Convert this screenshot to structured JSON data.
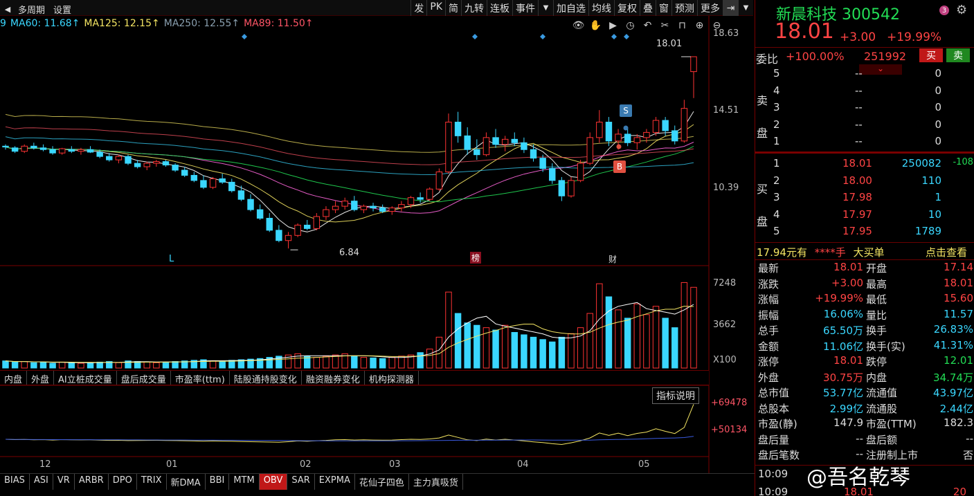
{
  "toolbar": {
    "left": [
      "多周期",
      "设置"
    ],
    "right": [
      "发",
      "PK",
      "简",
      "九转",
      "连板",
      "事件",
      "加自选",
      "均线",
      "复权",
      "叠",
      "窗",
      "预测",
      "更多"
    ]
  },
  "ma": [
    {
      "label": "9",
      "color": "#3ad7ff"
    },
    {
      "label": "MA60: 11.68↑",
      "color": "#3ad7ff"
    },
    {
      "label": "MA125: 12.15↑",
      "color": "#f5e663"
    },
    {
      "label": "MA250: 12.55↑",
      "color": "#8aa0b0"
    },
    {
      "label": "MA89: 11.50↑",
      "color": "#ff5566"
    }
  ],
  "price_axis": [
    "18.63",
    "14.51",
    "10.39"
  ],
  "vol_axis": [
    "7248",
    "3662",
    "X100"
  ],
  "obv_axis": [
    "+69478",
    "+50134"
  ],
  "x_axis": [
    "12",
    "01",
    "02",
    "03",
    "04",
    "05"
  ],
  "markers": {
    "low": "6.84",
    "high": "18.01",
    "L": "L",
    "bang": "榜",
    "cai": "财",
    "S": "S",
    "B": "B",
    "indicator_help": "指标说明"
  },
  "tabs_mid": [
    "内盘",
    "外盘",
    "AI立桩成交量",
    "盘后成交量",
    "市盈率(ttm)",
    "陆股通持股变化",
    "融资融券变化",
    "机构探测器"
  ],
  "tabs_bottom": [
    "BIAS",
    "ASI",
    "VR",
    "ARBR",
    "DPO",
    "TRIX",
    "新DMA",
    "BBI",
    "MTM",
    "OBV",
    "SAR",
    "EXPMA",
    "花仙子四色",
    "主力真吸货"
  ],
  "active_tab": "OBV",
  "stock": {
    "name": "新晨科技",
    "code": "300542",
    "badge": "3",
    "price": "18.01",
    "change": "+3.00",
    "pct": "+19.99%",
    "weibi_label": "委比",
    "weibi": "+100.00%",
    "weicha": "251992",
    "buy_btn": "买",
    "sell_btn": "卖"
  },
  "sell_label": [
    "卖",
    "盘"
  ],
  "buy_label": [
    "买",
    "盘"
  ],
  "asks": [
    {
      "lvl": "5",
      "price": "--",
      "vol": "0"
    },
    {
      "lvl": "4",
      "price": "--",
      "vol": "0"
    },
    {
      "lvl": "3",
      "price": "--",
      "vol": "0"
    },
    {
      "lvl": "2",
      "price": "--",
      "vol": "0"
    },
    {
      "lvl": "1",
      "price": "--",
      "vol": "0"
    }
  ],
  "bids": [
    {
      "lvl": "1",
      "price": "18.01",
      "vol": "250082",
      "chg": "-108"
    },
    {
      "lvl": "2",
      "price": "18.00",
      "vol": "110",
      "chg": ""
    },
    {
      "lvl": "3",
      "price": "17.98",
      "vol": "1",
      "chg": ""
    },
    {
      "lvl": "4",
      "price": "17.97",
      "vol": "10",
      "chg": ""
    },
    {
      "lvl": "5",
      "price": "17.95",
      "vol": "1789",
      "chg": ""
    }
  ],
  "bigorder": {
    "amount": "17.94元有",
    "hands": "****手",
    "label": "大买单",
    "link": "点击查看"
  },
  "stats": [
    [
      "最新",
      "18.01",
      "red",
      "开盘",
      "17.14",
      "red"
    ],
    [
      "涨跌",
      "+3.00",
      "red",
      "最高",
      "18.01",
      "red"
    ],
    [
      "涨幅",
      "+19.99%",
      "red",
      "最低",
      "15.60",
      "red"
    ],
    [
      "振幅",
      "16.06%",
      "cyan",
      "量比",
      "11.57",
      "cyan"
    ],
    [
      "总手",
      "65.50万",
      "cyan",
      "换手",
      "26.83%",
      "cyan"
    ],
    [
      "金额",
      "11.06亿",
      "cyan",
      "换手(实)",
      "41.31%",
      "cyan"
    ],
    [
      "涨停",
      "18.01",
      "red",
      "跌停",
      "12.01",
      "green"
    ],
    [
      "外盘",
      "30.75万",
      "red",
      "内盘",
      "34.74万",
      "green"
    ],
    [
      "总市值",
      "53.77亿",
      "cyan",
      "流通值",
      "43.97亿",
      "cyan"
    ],
    [
      "总股本",
      "2.99亿",
      "cyan",
      "流通股",
      "2.44亿",
      "cyan"
    ],
    [
      "市盈(静)",
      "147.9",
      "white",
      "市盈(TTM)",
      "182.3",
      "white"
    ],
    [
      "盘后量",
      "--",
      "white",
      "盘后额",
      "--",
      "white"
    ],
    [
      "盘后笔数",
      "--",
      "white",
      "注册制上市",
      "否",
      "white"
    ]
  ],
  "ticks": [
    {
      "time": "10:09",
      "price": "",
      "vol": ""
    },
    {
      "time": "10:09",
      "price": "18.01",
      "vol": "20"
    }
  ],
  "watermark": "@吾名乾琴",
  "chart_data": {
    "type": "candlestick",
    "price_ylim": [
      6.0,
      19.5
    ],
    "candles": [
      [
        12.8,
        12.9,
        12.6,
        12.75
      ],
      [
        12.7,
        12.8,
        12.4,
        12.5
      ],
      [
        12.5,
        12.9,
        12.4,
        12.8
      ],
      [
        12.8,
        13.0,
        12.6,
        12.7
      ],
      [
        12.7,
        12.9,
        12.5,
        12.6
      ],
      [
        12.6,
        12.8,
        12.3,
        12.4
      ],
      [
        12.4,
        12.7,
        12.3,
        12.65
      ],
      [
        12.6,
        12.8,
        12.4,
        12.5
      ],
      [
        12.5,
        12.7,
        12.3,
        12.6
      ],
      [
        12.6,
        12.8,
        12.4,
        12.45
      ],
      [
        12.45,
        12.6,
        12.1,
        12.2
      ],
      [
        12.2,
        12.4,
        11.9,
        12.0
      ],
      [
        12.0,
        12.3,
        11.8,
        12.2
      ],
      [
        12.2,
        12.3,
        11.7,
        11.8
      ],
      [
        11.8,
        12.0,
        11.5,
        11.6
      ],
      [
        11.6,
        11.9,
        11.4,
        11.8
      ],
      [
        11.8,
        12.0,
        11.6,
        11.9
      ],
      [
        11.9,
        12.0,
        11.6,
        11.7
      ],
      [
        11.7,
        11.8,
        11.3,
        11.4
      ],
      [
        11.4,
        11.6,
        11.0,
        11.1
      ],
      [
        11.1,
        11.3,
        10.7,
        10.8
      ],
      [
        10.8,
        11.1,
        10.3,
        10.4
      ],
      [
        10.4,
        11.0,
        10.3,
        10.9
      ],
      [
        10.9,
        11.2,
        10.6,
        10.7
      ],
      [
        10.7,
        10.9,
        10.1,
        10.2
      ],
      [
        10.2,
        10.5,
        9.6,
        9.7
      ],
      [
        9.7,
        10.0,
        9.0,
        9.1
      ],
      [
        9.1,
        9.4,
        8.5,
        8.6
      ],
      [
        8.6,
        8.9,
        7.8,
        7.9
      ],
      [
        7.9,
        8.2,
        7.2,
        7.3
      ],
      [
        7.3,
        7.8,
        6.84,
        7.6
      ],
      [
        7.6,
        8.3,
        7.5,
        8.2
      ],
      [
        8.2,
        8.5,
        7.9,
        8.0
      ],
      [
        8.0,
        8.9,
        7.9,
        8.7
      ],
      [
        8.7,
        9.3,
        8.5,
        9.1
      ],
      [
        9.1,
        9.6,
        8.9,
        9.3
      ],
      [
        9.3,
        9.8,
        9.1,
        9.6
      ],
      [
        9.6,
        9.9,
        9.0,
        9.1
      ],
      [
        9.1,
        9.4,
        8.9,
        9.3
      ],
      [
        9.3,
        9.5,
        9.0,
        9.2
      ],
      [
        9.2,
        9.4,
        8.9,
        9.0
      ],
      [
        9.0,
        9.3,
        8.8,
        9.2
      ],
      [
        9.2,
        9.6,
        9.0,
        9.4
      ],
      [
        9.4,
        9.9,
        9.2,
        9.8
      ],
      [
        9.8,
        10.1,
        9.5,
        9.7
      ],
      [
        9.7,
        10.4,
        9.6,
        10.3
      ],
      [
        10.3,
        11.5,
        10.2,
        11.3
      ],
      [
        11.3,
        14.7,
        11.2,
        14.2
      ],
      [
        14.2,
        14.8,
        13.0,
        13.4
      ],
      [
        13.4,
        13.9,
        12.3,
        12.6
      ],
      [
        12.6,
        13.2,
        12.0,
        12.3
      ],
      [
        12.3,
        13.6,
        12.2,
        13.3
      ],
      [
        13.3,
        13.8,
        12.7,
        12.9
      ],
      [
        12.9,
        13.4,
        12.5,
        13.2
      ],
      [
        13.2,
        13.6,
        12.8,
        13.0
      ],
      [
        13.0,
        13.3,
        12.4,
        12.6
      ],
      [
        12.6,
        12.9,
        11.9,
        12.1
      ],
      [
        12.1,
        12.3,
        11.3,
        11.5
      ],
      [
        11.5,
        11.8,
        10.6,
        10.8
      ],
      [
        10.8,
        11.0,
        9.6,
        9.9
      ],
      [
        9.9,
        11.0,
        9.8,
        10.8
      ],
      [
        10.8,
        12.0,
        10.7,
        11.8
      ],
      [
        11.8,
        13.6,
        11.7,
        13.3
      ],
      [
        13.3,
        14.9,
        13.0,
        14.2
      ],
      [
        14.2,
        14.5,
        12.8,
        13.1
      ],
      [
        13.1,
        13.8,
        12.6,
        13.5
      ],
      [
        13.5,
        13.9,
        12.8,
        13.0
      ],
      [
        13.0,
        13.5,
        12.6,
        13.3
      ],
      [
        13.3,
        13.8,
        13.0,
        13.6
      ],
      [
        13.6,
        14.5,
        13.4,
        14.3
      ],
      [
        14.3,
        14.5,
        13.4,
        13.7
      ],
      [
        13.7,
        14.0,
        12.9,
        13.1
      ],
      [
        13.1,
        15.5,
        13.0,
        15.0
      ],
      [
        17.14,
        18.01,
        15.6,
        18.01
      ]
    ],
    "volumes": [
      0.6,
      0.5,
      0.55,
      0.45,
      0.5,
      0.4,
      0.5,
      0.45,
      0.4,
      0.45,
      0.5,
      0.55,
      0.45,
      0.6,
      0.55,
      0.5,
      0.45,
      0.5,
      0.55,
      0.6,
      0.65,
      0.7,
      0.6,
      0.55,
      0.65,
      0.7,
      0.75,
      0.8,
      0.9,
      1.0,
      1.1,
      1.2,
      1.0,
      0.9,
      1.0,
      1.1,
      1.2,
      1.0,
      0.9,
      0.85,
      0.8,
      0.9,
      1.0,
      1.1,
      1.3,
      1.6,
      2.6,
      6.4,
      4.6,
      3.8,
      3.6,
      3.4,
      3.2,
      3.6,
      3.0,
      2.8,
      2.6,
      2.4,
      2.2,
      2.6,
      2.9,
      3.4,
      4.6,
      7.1,
      6.0,
      4.9,
      4.2,
      5.4,
      4.5,
      5.2,
      4.2,
      3.4,
      7.2,
      6.8
    ],
    "obv": [
      50500,
      50300,
      50400,
      50200,
      50300,
      50100,
      50300,
      50200,
      50150,
      50250,
      50000,
      49900,
      49950,
      49800,
      49850,
      49900,
      49950,
      49850,
      49800,
      49700,
      49600,
      49500,
      49600,
      49500,
      49400,
      49300,
      49200,
      49100,
      49000,
      48900,
      49200,
      49600,
      49400,
      49700,
      49900,
      50200,
      50300,
      50100,
      50200,
      50100,
      50000,
      50100,
      50300,
      50500,
      50400,
      50700,
      51200,
      52800,
      51500,
      50200,
      49800,
      50600,
      50100,
      50500,
      50100,
      49600,
      49100,
      48700,
      48100,
      47700,
      48600,
      49700,
      51200,
      53900,
      52600,
      53800,
      52500,
      53700,
      54400,
      56200,
      54800,
      53600,
      56900,
      69478
    ],
    "obv_ylim": [
      43000,
      73000
    ],
    "signals": {
      "low_index": 30,
      "bang_index": 47,
      "cai_index": 63,
      "S_index": 65,
      "B_index": 64
    }
  }
}
